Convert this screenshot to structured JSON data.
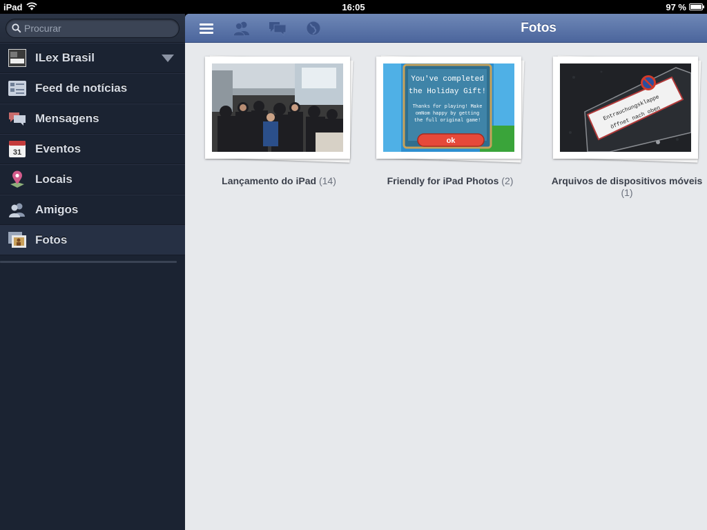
{
  "status": {
    "device": "iPad",
    "time": "16:05",
    "battery_text": "97 %",
    "battery_level": 0.97
  },
  "search": {
    "placeholder": "Procurar"
  },
  "sidebar": {
    "items": [
      {
        "label": "ILex Brasil",
        "icon": "profile-thumbnail-icon"
      },
      {
        "label": "Feed de notícias",
        "icon": "news-feed-icon"
      },
      {
        "label": "Mensagens",
        "icon": "messages-icon"
      },
      {
        "label": "Eventos",
        "icon": "calendar-icon",
        "icon_text": "31"
      },
      {
        "label": "Locais",
        "icon": "map-pin-icon"
      },
      {
        "label": "Amigos",
        "icon": "friends-icon"
      },
      {
        "label": "Fotos",
        "icon": "photos-icon",
        "active": true
      }
    ]
  },
  "header": {
    "title": "Fotos",
    "buttons": [
      "menu-icon",
      "friend-requests-icon",
      "messages-icon",
      "notifications-globe-icon"
    ]
  },
  "albums": [
    {
      "name": "Lançamento do iPad",
      "count": "(14)"
    },
    {
      "name": "Friendly for iPad Photos",
      "count": "(2)",
      "image_text": [
        "You've completed",
        "the Holiday Gift!",
        "Thanks for playing! Make",
        "omNom happy by getting",
        "the full original game!",
        "ok"
      ]
    },
    {
      "name": "Arquivos de dispositivos móveis",
      "count": "(1)",
      "image_text": [
        "Entrauchungsklappe",
        "öffnet nach oben"
      ]
    }
  ],
  "colors": {
    "nav_top": "#6f88b7",
    "nav_bottom": "#4b659c",
    "sidebar_bg": "#1b2332",
    "main_bg": "#e7e9ec"
  }
}
